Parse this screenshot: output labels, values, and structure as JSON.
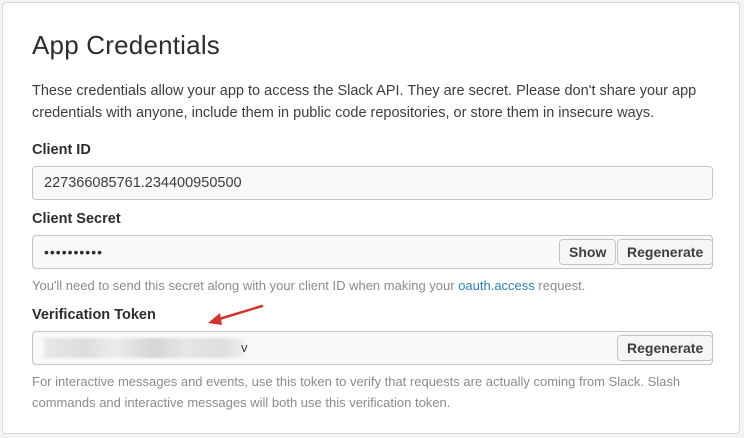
{
  "title": "App Credentials",
  "description": "These credentials allow your app to access the Slack API. They are secret. Please don't share your app credentials with anyone, include them in public code repositories, or store them in insecure ways.",
  "client_id": {
    "label": "Client ID",
    "value": "227366085761.234400950500"
  },
  "client_secret": {
    "label": "Client Secret",
    "value": "••••••••••",
    "show_label": "Show",
    "regenerate_label": "Regenerate",
    "hint_prefix": "You'll need to send this secret along with your client ID when making your ",
    "hint_link": "oauth.access",
    "hint_suffix": " request."
  },
  "verification_token": {
    "label": "Verification Token",
    "value_tail": "v",
    "regenerate_label": "Regenerate",
    "hint": "For interactive messages and events, use this token to verify that requests are actually coming from Slack. Slash commands and interactive messages will both use this verification token."
  },
  "colors": {
    "link": "#2a80b9",
    "annotation_arrow": "#d0342c"
  }
}
